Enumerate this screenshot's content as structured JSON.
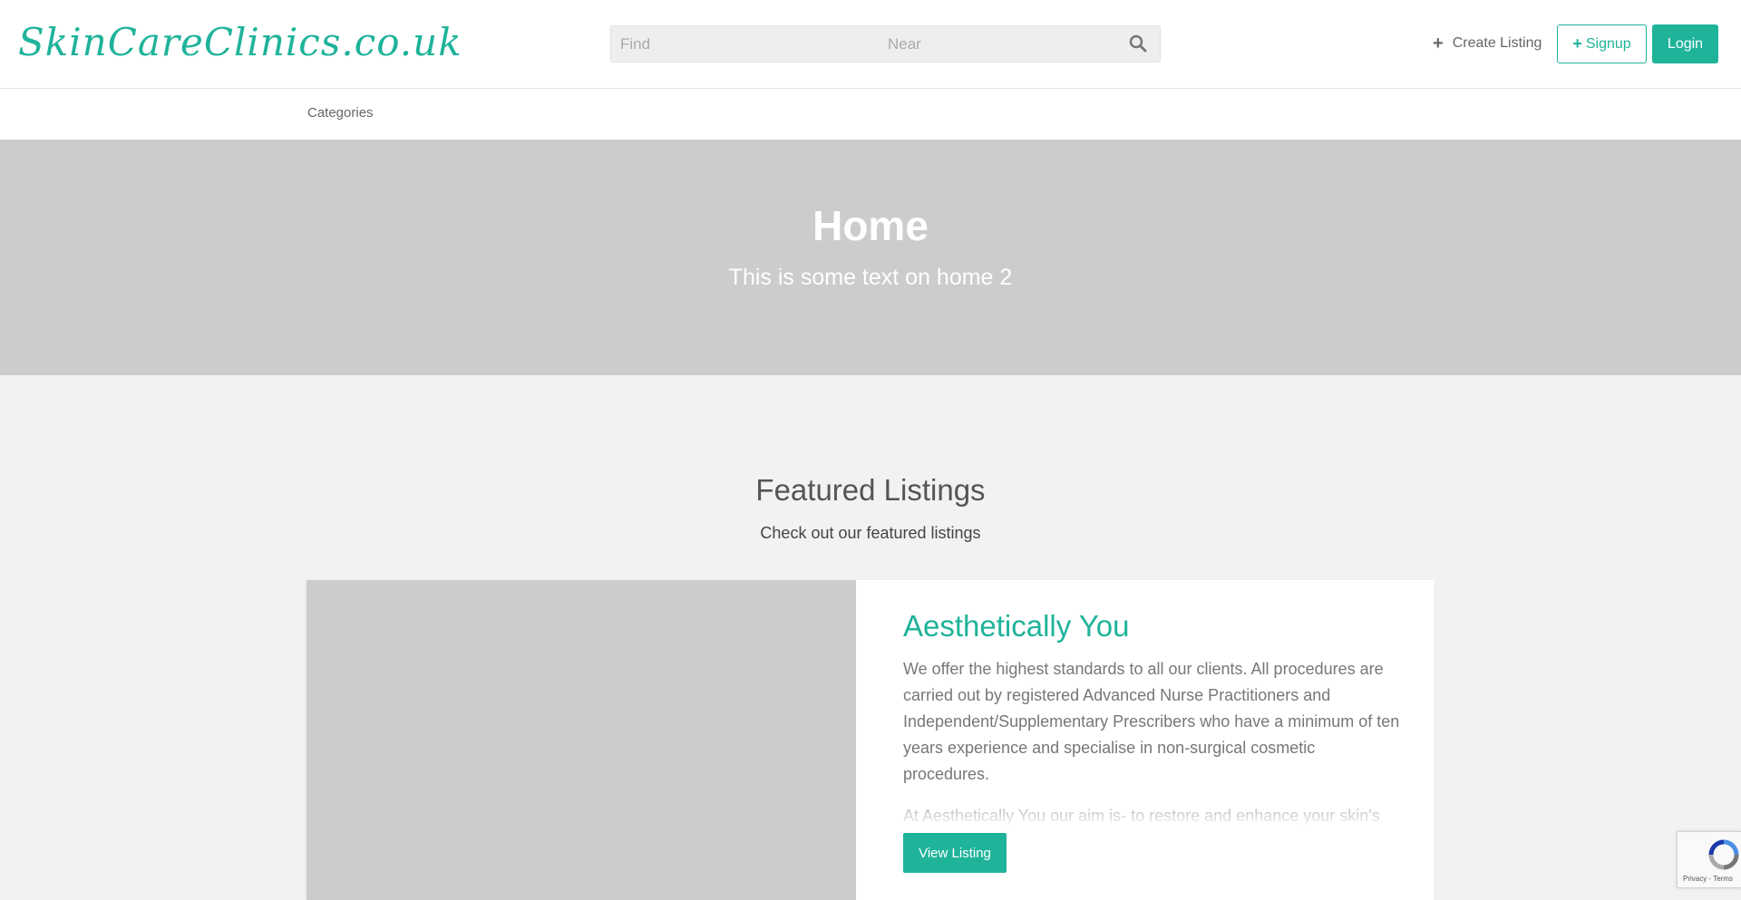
{
  "header": {
    "logo_text": "SkinCareClinics.co.uk",
    "search": {
      "find_placeholder": "Find",
      "near_placeholder": "Near",
      "button_icon": "search-icon"
    },
    "create_listing_label": "Create Listing",
    "signup_label": "Signup",
    "login_label": "Login"
  },
  "subnav": {
    "categories_label": "Categories"
  },
  "hero": {
    "title": "Home",
    "subtitle": "This is some text on home 2"
  },
  "featured": {
    "title": "Featured Listings",
    "subtitle": "Check out our featured listings",
    "listing": {
      "title": "Aesthetically You",
      "paragraph_1": "We offer the highest standards to all our clients. All procedures are carried out by registered Advanced Nurse Practitioners and Independent/Supplementary Prescribers who have a minimum of ten years experience and specialise in non-surgical cosmetic procedures.",
      "paragraph_2": "At Aesthetically You our aim is- to restore and enhance your skin's natural beauty whilst maintaining a fresh and natural look. We specialise in",
      "button_label": "View Listing"
    }
  },
  "recaptcha": {
    "terms_text": "Privacy - Terms"
  },
  "colors": {
    "accent": "#1fb39a",
    "hero_bg": "#cccccc",
    "page_bg": "#f2f2f2"
  }
}
